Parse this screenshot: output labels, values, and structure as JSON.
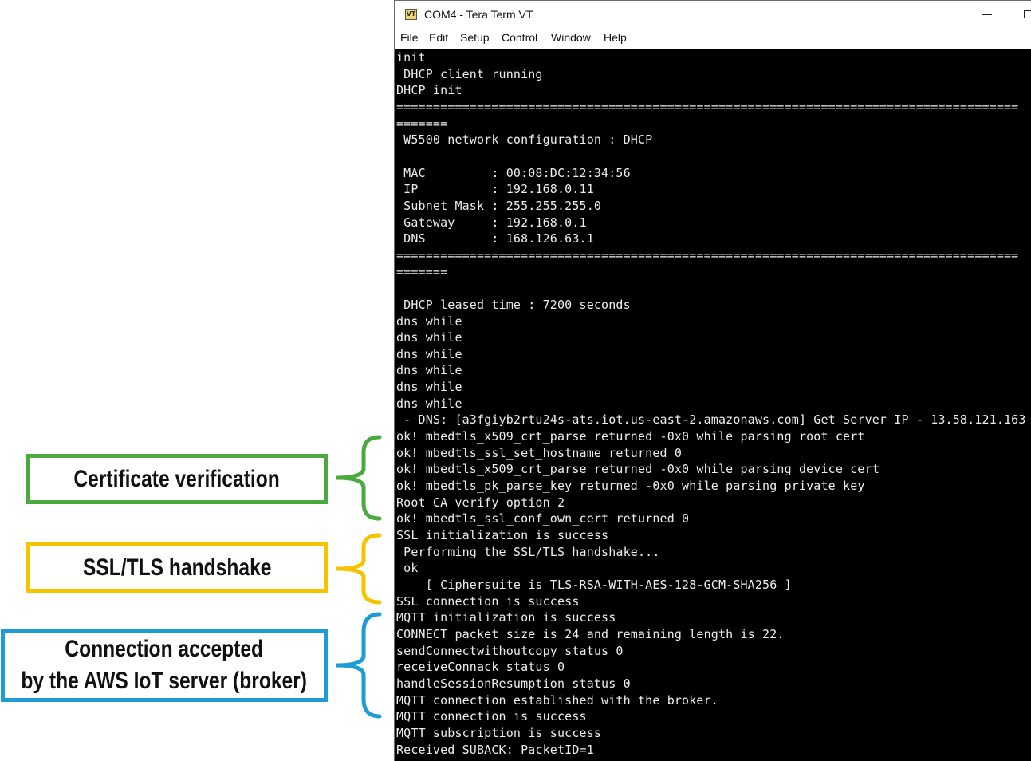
{
  "annotations": {
    "certificate": {
      "label": "Certificate verification",
      "color": "#4aa93f"
    },
    "ssl": {
      "label": "SSL/TLS handshake",
      "color": "#f5c400"
    },
    "connection": {
      "line1": "Connection accepted",
      "line2": "by the AWS IoT server (broker)",
      "color": "#1e9cd7"
    }
  },
  "window": {
    "title": "COM4 - Tera Term VT",
    "icon": "tera-term-icon",
    "menu": [
      "File",
      "Edit",
      "Setup",
      "Control",
      "Window",
      "Help"
    ]
  },
  "terminal": {
    "background": "#000000",
    "foreground": "#ededed",
    "lines": [
      "init",
      " DHCP client running",
      "DHCP init",
      "=====================================================================================",
      "=======",
      " W5500 network configuration : DHCP",
      "",
      " MAC         : 00:08:DC:12:34:56",
      " IP          : 192.168.0.11",
      " Subnet Mask : 255.255.255.0",
      " Gateway     : 192.168.0.1",
      " DNS         : 168.126.63.1",
      "=====================================================================================",
      "=======",
      "",
      " DHCP leased time : 7200 seconds",
      "dns while",
      "dns while",
      "dns while",
      "dns while",
      "dns while",
      "dns while",
      " - DNS: [a3fgiyb2rtu24s-ats.iot.us-east-2.amazonaws.com] Get Server IP - 13.58.121.163",
      "ok! mbedtls_x509_crt_parse returned -0x0 while parsing root cert",
      "ok! mbedtls_ssl_set_hostname returned 0",
      "ok! mbedtls_x509_crt_parse returned -0x0 while parsing device cert",
      "ok! mbedtls_pk_parse_key returned -0x0 while parsing private key",
      "Root CA verify option 2",
      "ok! mbedtls_ssl_conf_own_cert returned 0",
      "SSL initialization is success",
      " Performing the SSL/TLS handshake...",
      " ok",
      "    [ Ciphersuite is TLS-RSA-WITH-AES-128-GCM-SHA256 ]",
      "SSL connection is success",
      "MQTT initialization is success",
      "CONNECT packet size is 24 and remaining length is 22.",
      "sendConnectwithoutcopy status 0",
      "receiveConnack status 0",
      "handleSessionResumption status 0",
      "MQTT connection established with the broker.",
      "MQTT connection is success",
      "MQTT subscription is success",
      "Received SUBACK: PacketID=1"
    ]
  }
}
